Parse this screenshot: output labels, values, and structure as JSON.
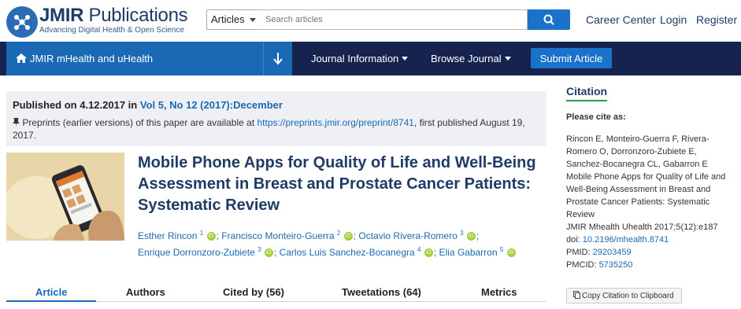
{
  "header": {
    "brand_bold": "JMIR",
    "brand_rest": " Publications",
    "tagline": "Advancing Digital Health & Open Science",
    "search": {
      "scope": "Articles",
      "placeholder": "Search articles"
    },
    "links": [
      "Career Center",
      "Login",
      "Register"
    ]
  },
  "nav": {
    "journal": "JMIR mHealth and uHealth",
    "items": [
      "Journal Information",
      "Browse Journal"
    ],
    "submit": "Submit Article"
  },
  "publication": {
    "published_prefix": "Published on 4.12.2017 in ",
    "volume": "Vol 5, No 12 (2017):December",
    "preprint_text": "Preprints (earlier versions) of this paper are available at ",
    "preprint_link": "https://preprints.jmir.org/preprint/8741",
    "preprint_suffix": ", first published August 19, 2017."
  },
  "article": {
    "title": "Mobile Phone Apps for Quality of Life and Well-Being Assessment in Breast and Prostate Cancer Patients: Systematic Review",
    "authors": [
      {
        "name": "Esther Rincon",
        "aff": "1"
      },
      {
        "name": "Francisco Monteiro-Guerra",
        "aff": "2"
      },
      {
        "name": "Octavio Rivera-Romero",
        "aff": "3"
      },
      {
        "name": "Enrique Dorronzoro-Zubiete",
        "aff": "3"
      },
      {
        "name": "Carlos Luis Sanchez-Bocanegra",
        "aff": "4"
      },
      {
        "name": "Elia Gabarron",
        "aff": "5"
      }
    ],
    "orcid_label": "iD"
  },
  "tabs": [
    "Article",
    "Authors",
    "Cited by (56)",
    "Tweetations (64)",
    "Metrics"
  ],
  "citation": {
    "title": "Citation",
    "please": "Please cite as:",
    "text": "Rincon E, Monteiro-Guerra F, Rivera-Romero O, Dorronzoro-Zubiete E, Sanchez-Bocanegra CL, Gabarron E Mobile Phone Apps for Quality of Life and Well-Being Assessment in Breast and Prostate Cancer Patients: Systematic Review",
    "journal_ref": "JMIR Mhealth Uhealth 2017;5(12):e187",
    "doi_label": "doi: ",
    "doi": "10.2196/mhealth.8741",
    "pmid_label": "PMID: ",
    "pmid": "29203459",
    "pmcid_label": "PMCID: ",
    "pmcid": "5735250",
    "copy_button": "Copy Citation to Clipboard"
  },
  "colors": {
    "navy": "#17234f",
    "blue": "#1a69b4",
    "orcid": "#a6ce39"
  }
}
